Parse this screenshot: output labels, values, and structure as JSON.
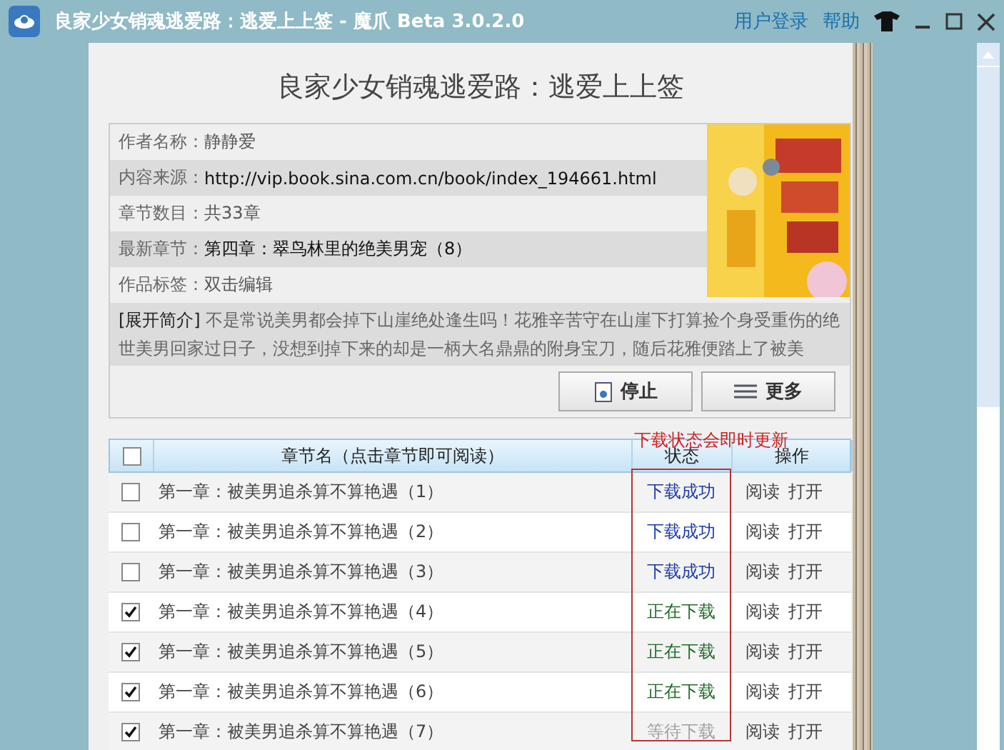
{
  "window": {
    "title": "良家少女销魂逃爱路：逃爱上上签 - 魔爪 Beta 3.0.2.0",
    "links": [
      "用户登录",
      "帮助"
    ]
  },
  "book": {
    "title": "良家少女销魂逃爱路：逃爱上上签",
    "fields": [
      {
        "label": "作者名称：",
        "value": "静静爱",
        "kind": "plain"
      },
      {
        "label": "内容来源：",
        "value": "http://vip.book.sina.com.cn/book/index_194661.html",
        "kind": "dark"
      },
      {
        "label": "章节数目：",
        "value": "共33章",
        "kind": "plain"
      },
      {
        "label": "最新章节：",
        "value": "第四章：翠鸟林里的绝美男宠（8）",
        "kind": "dark"
      },
      {
        "label": "作品标签：",
        "value": "双击编辑",
        "kind": "plain"
      }
    ],
    "synopsis_link": "[展开简介]",
    "synopsis": "不是常说美男都会掉下山崖绝处逢生吗！花雅辛苦守在山崖下打算捡个身受重伤的绝世美男回家过日子，没想到掉下来的却是一柄大名鼎鼎的附身宝刀，随后花雅便踏上了被美",
    "buttons": [
      "停止",
      "更多"
    ]
  },
  "table": {
    "select_all": false,
    "columns": [
      "章节名（点击章节即可阅读）",
      "状态",
      "操作"
    ],
    "annotation": "下载状态会即时更新",
    "rows": [
      {
        "checked": false,
        "name": "第一章：被美男追杀算不算艳遇（1）",
        "status": "下载成功",
        "kind": "done",
        "actions": [
          "阅读",
          "打开"
        ]
      },
      {
        "checked": false,
        "name": "第一章：被美男追杀算不算艳遇（2）",
        "status": "下载成功",
        "kind": "done",
        "actions": [
          "阅读",
          "打开"
        ]
      },
      {
        "checked": false,
        "name": "第一章：被美男追杀算不算艳遇（3）",
        "status": "下载成功",
        "kind": "done",
        "actions": [
          "阅读",
          "打开"
        ]
      },
      {
        "checked": true,
        "name": "第一章：被美男追杀算不算艳遇（4）",
        "status": "正在下载",
        "kind": "downloading",
        "actions": [
          "阅读",
          "打开"
        ]
      },
      {
        "checked": true,
        "name": "第一章：被美男追杀算不算艳遇（5）",
        "status": "正在下载",
        "kind": "downloading",
        "actions": [
          "阅读",
          "打开"
        ]
      },
      {
        "checked": true,
        "name": "第一章：被美男追杀算不算艳遇（6）",
        "status": "正在下载",
        "kind": "downloading",
        "actions": [
          "阅读",
          "打开"
        ]
      },
      {
        "checked": true,
        "name": "第一章：被美男追杀算不算艳遇（7）",
        "status": "等待下载",
        "kind": "waiting",
        "actions": [
          "阅读",
          "打开"
        ]
      }
    ]
  }
}
